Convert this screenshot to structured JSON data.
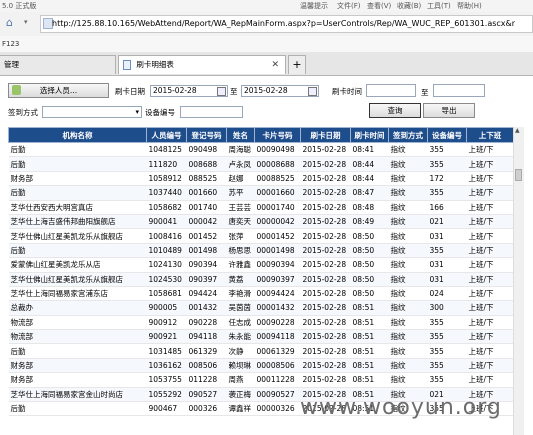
{
  "browser": {
    "title_fragment": "5.0 正式版",
    "menu": [
      "温馨提示",
      "文件(F)",
      "查看(V)",
      "收藏(B)",
      "工具(T)",
      "帮助(H)"
    ],
    "url": "http://125.88.10.165/WebAttend/Report/WA_RepMainForm.aspx?p=UserControls/Rep/WA_WUC_REP_601301.ascx&r",
    "favorites_fragment": "F123",
    "tabs": [
      {
        "label": "管理",
        "active": false
      },
      {
        "label": "刷卡明细表",
        "active": true
      }
    ],
    "new_tab_symbol": "+"
  },
  "form": {
    "select_person_label": "选择人员...",
    "swipe_date_label": "刷卡日期",
    "date_from": "2015-02-28",
    "date_to_sep": "至",
    "date_to": "2015-02-28",
    "swipe_time_label": "刷卡时间",
    "time_to_sep": "至",
    "sign_method_label": "签到方式",
    "device_label": "设备编号",
    "query_button": "查询",
    "export_button": "导出"
  },
  "table": {
    "columns": [
      "机构名称",
      "人员编号",
      "登记号码",
      "姓名",
      "卡片号码",
      "刷卡日期",
      "刷卡时间",
      "签到方式",
      "设备编号",
      "上下班"
    ],
    "rows": [
      [
        "后勤",
        "1048125",
        "090498",
        "周海聪",
        "00090498",
        "2015-02-28",
        "08:41",
        "指纹",
        "355",
        "上班/下"
      ],
      [
        "后勤",
        "111820",
        "008688",
        "卢永凤",
        "00008688",
        "2015-02-28",
        "08:44",
        "指纹",
        "355",
        "上班/下"
      ],
      [
        "财务部",
        "1058912",
        "088525",
        "赵娜",
        "00088525",
        "2015-02-28",
        "08:44",
        "指纹",
        "172",
        "上班/下"
      ],
      [
        "后勤",
        "1037440",
        "001660",
        "苏平",
        "00001660",
        "2015-02-28",
        "08:47",
        "指纹",
        "355",
        "上班/下"
      ],
      [
        "芝华仕西安西大明宫真店",
        "1058682",
        "001740",
        "王芸芸",
        "00001740",
        "2015-02-28",
        "08:48",
        "指纹",
        "166",
        "上班/下"
      ],
      [
        "芝华仕上海吉盛伟邦曲阳旗舰店",
        "900041",
        "000042",
        "唐奕天",
        "00000042",
        "2015-02-28",
        "08:49",
        "指纹",
        "021",
        "上班/下"
      ],
      [
        "芝华仕佛山红星美凯龙乐从旗舰店",
        "1008416",
        "001452",
        "张萍",
        "00001452",
        "2015-02-28",
        "08:50",
        "指纹",
        "031",
        "上班/下"
      ],
      [
        "后勤",
        "1010489",
        "001498",
        "杨思思",
        "00001498",
        "2015-02-28",
        "08:50",
        "指纹",
        "355",
        "上班/下"
      ],
      [
        "爱蒙佛山红星美凯龙乐从店",
        "1024130",
        "090394",
        "许雅鑫",
        "00090394",
        "2015-02-28",
        "08:50",
        "指纹",
        "031",
        "上班/下"
      ],
      [
        "芝华仕佛山红星美凯龙乐从旗舰店",
        "1024530",
        "090397",
        "黄荔",
        "00090397",
        "2015-02-28",
        "08:50",
        "指纹",
        "031",
        "上班/下"
      ],
      [
        "芝华仕上海同福易家宫浦东店",
        "1058681",
        "094424",
        "李艳滑",
        "00094424",
        "2015-02-28",
        "08:50",
        "指纹",
        "024",
        "上班/下"
      ],
      [
        "总裁办",
        "900005",
        "001432",
        "吴茵茵",
        "00001432",
        "2015-02-28",
        "08:51",
        "指纹",
        "300",
        "上班/下"
      ],
      [
        "物流部",
        "900912",
        "090228",
        "任志成",
        "00090228",
        "2015-02-28",
        "08:51",
        "指纹",
        "355",
        "上班/下"
      ],
      [
        "物流部",
        "900921",
        "094118",
        "朱永能",
        "00094118",
        "2015-02-28",
        "08:51",
        "指纹",
        "355",
        "上班/下"
      ],
      [
        "后勤",
        "1031485",
        "061329",
        "次静",
        "00061329",
        "2015-02-28",
        "08:51",
        "指纹",
        "355",
        "上班/下"
      ],
      [
        "财务部",
        "1036162",
        "008506",
        "赖坝琳",
        "00008506",
        "2015-02-28",
        "08:51",
        "指纹",
        "355",
        "上班/下"
      ],
      [
        "财务部",
        "1053755",
        "011228",
        "周燕",
        "00011228",
        "2015-02-28",
        "08:51",
        "指纹",
        "355",
        "上班/下"
      ],
      [
        "芝华仕上海同福易家宫金山时尚店",
        "1055292",
        "090527",
        "袭正梅",
        "00090527",
        "2015-02-28",
        "08:51",
        "指纹",
        "021",
        "上班/下"
      ],
      [
        "后勤",
        "900467",
        "000326",
        "谭鑫祥",
        "00000326",
        "2015-02-28",
        "08:51",
        "指纹",
        "355",
        "上班/下"
      ]
    ]
  },
  "watermark": "www.wooyun.org",
  "colors": {
    "header_bg": "#1e4d8c",
    "header_fg": "#ffffff",
    "button_border": "#8a8a8a"
  }
}
